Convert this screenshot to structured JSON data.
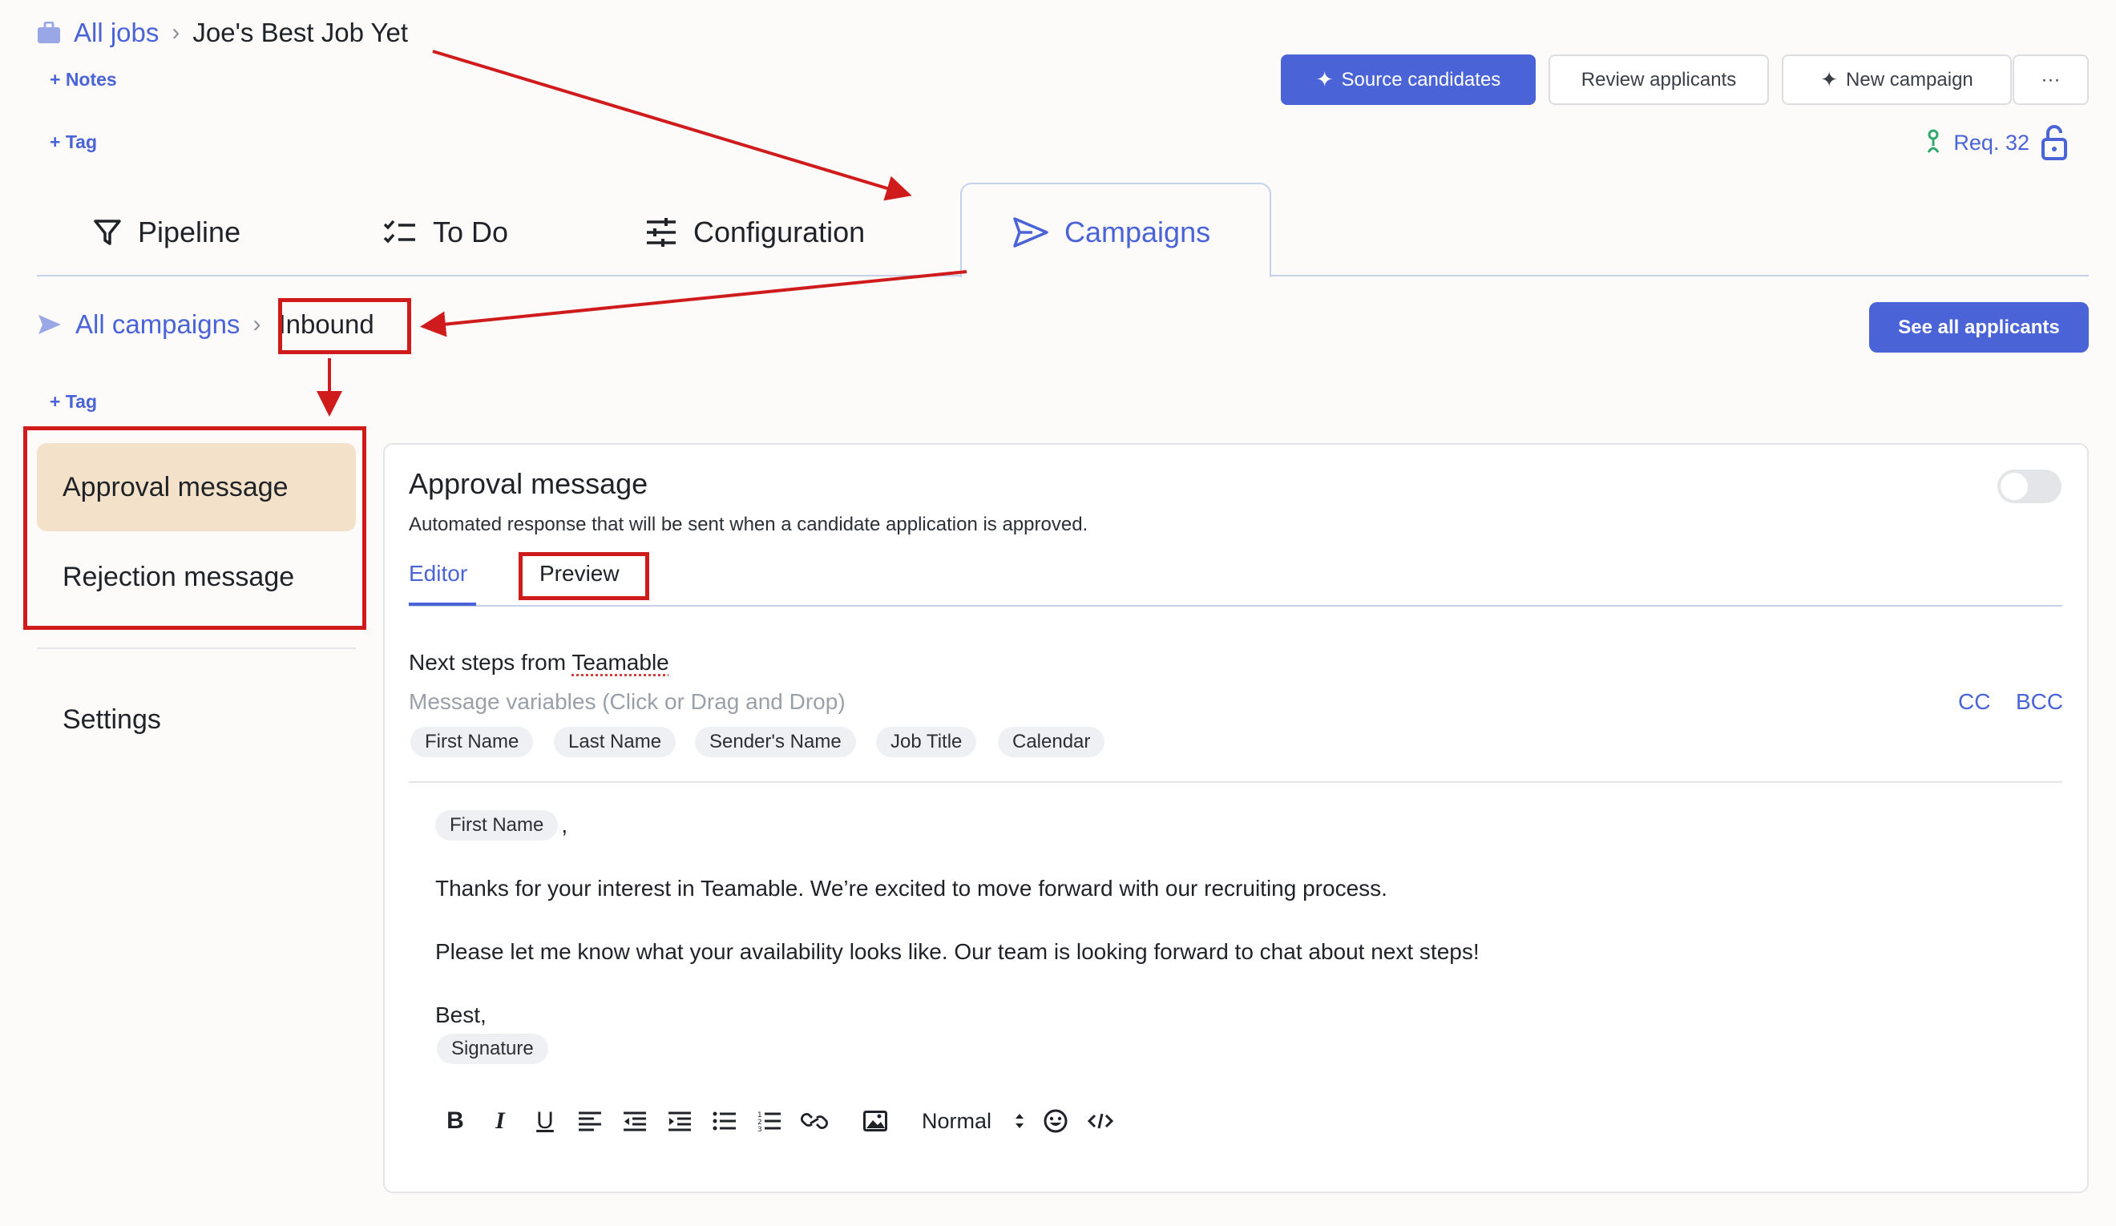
{
  "header": {
    "breadcrumb_root": "All jobs",
    "breadcrumb_current": "Joe's Best Job Yet",
    "notes_link": "+ Notes",
    "tag_link": "+ Tag"
  },
  "actions": {
    "source_candidates": "Source candidates",
    "review_applicants": "Review applicants",
    "new_campaign": "New campaign",
    "more": "···"
  },
  "requisition": {
    "label": "Req. 32"
  },
  "tabs": [
    {
      "label": "Pipeline",
      "icon": "filter-icon"
    },
    {
      "label": "To Do",
      "icon": "checklist-icon"
    },
    {
      "label": "Configuration",
      "icon": "sliders-icon"
    },
    {
      "label": "Campaigns",
      "icon": "send-icon",
      "active": true
    }
  ],
  "campaign_breadcrumb": {
    "root": "All campaigns",
    "current": "Inbound",
    "tag_link": "+ Tag",
    "see_all": "See all applicants"
  },
  "sidebar": {
    "items": [
      {
        "label": "Approval message",
        "active": true
      },
      {
        "label": "Rejection message",
        "active": false
      }
    ],
    "settings": "Settings"
  },
  "editor": {
    "title": "Approval message",
    "subtitle": "Automated response that will be sent when a candidate application is approved.",
    "enabled": false,
    "subtabs": [
      "Editor",
      "Preview"
    ],
    "subject_prefix": "Next steps from ",
    "subject_company": "Teamable",
    "variables_label": "Message variables (Click or Drag and Drop)",
    "cc": "CC",
    "bcc": "BCC",
    "variables": [
      "First Name",
      "Last Name",
      "Sender's Name",
      "Job Title",
      "Calendar"
    ],
    "body": {
      "greeting_chip": "First Name",
      "greeting_suffix": ",",
      "line1": "Thanks for your interest in Teamable. We’re excited to move forward with our recruiting process.",
      "line2": "Please let me know what your availability looks like. Our team is looking forward to chat about next steps!",
      "signoff": "Best,",
      "signature_chip": "Signature"
    },
    "toolbar": {
      "bold": "B",
      "italic": "I",
      "underline": "U",
      "text_style": "Normal"
    }
  },
  "colors": {
    "accent": "#4a63d6",
    "active_menu": "#f3e2c9",
    "annotation": "#cf1b1b"
  }
}
